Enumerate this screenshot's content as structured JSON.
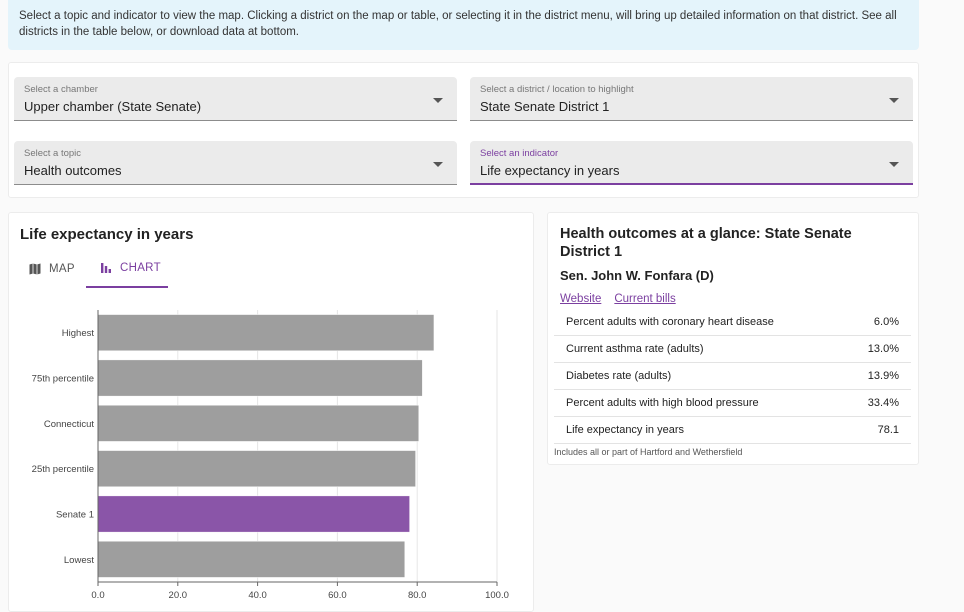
{
  "banner": {
    "text": "Select a topic and indicator to view the map. Clicking a district on the map or table, or selecting it in the district menu, will bring up detailed information on that district. See all districts in the table below, or download data at bottom."
  },
  "controls": {
    "chamber": {
      "label": "Select a chamber",
      "value": "Upper chamber (State Senate)"
    },
    "district": {
      "label": "Select a district / location to highlight",
      "value": "State Senate District 1"
    },
    "topic": {
      "label": "Select a topic",
      "value": "Health outcomes"
    },
    "indicator": {
      "label": "Select an indicator",
      "value": "Life expectancy in years"
    }
  },
  "chart_panel": {
    "title": "Life expectancy in years",
    "tabs": [
      {
        "label": "MAP",
        "icon": "map-icon",
        "selected": false
      },
      {
        "label": "CHART",
        "icon": "bar-chart-icon",
        "selected": true
      }
    ]
  },
  "chart_data": {
    "type": "bar",
    "orientation": "horizontal",
    "categories": [
      "Highest",
      "75th percentile",
      "Connecticut",
      "25th percentile",
      "Senate 1",
      "Lowest"
    ],
    "values": [
      84.2,
      81.3,
      80.4,
      79.6,
      78.1,
      76.9
    ],
    "highlight": "Senate 1",
    "colors": {
      "default": "#9e9e9e",
      "highlight": "#8a55a8"
    },
    "xticks": [
      "0.0",
      "20.0",
      "40.0",
      "60.0",
      "80.0",
      "100.0"
    ],
    "xlim": [
      0,
      100
    ],
    "grid": true
  },
  "glance": {
    "title": "Health outcomes at a glance: State Senate District 1",
    "legislator": "Sen. John W. Fonfara (D)",
    "links": [
      "Website",
      "Current bills"
    ],
    "rows": [
      {
        "label": "Percent adults with coronary heart disease",
        "value": "6.0%"
      },
      {
        "label": "Current asthma rate (adults)",
        "value": "13.0%"
      },
      {
        "label": "Diabetes rate (adults)",
        "value": "13.9%"
      },
      {
        "label": "Percent adults with high blood pressure",
        "value": "33.4%"
      },
      {
        "label": "Life expectancy in years",
        "value": "78.1"
      }
    ],
    "footnote": "Includes all or part of Hartford and Wethersfield"
  },
  "theme": {
    "accent": "#7b3fa0",
    "banner_bg": "#e4f4fb"
  }
}
